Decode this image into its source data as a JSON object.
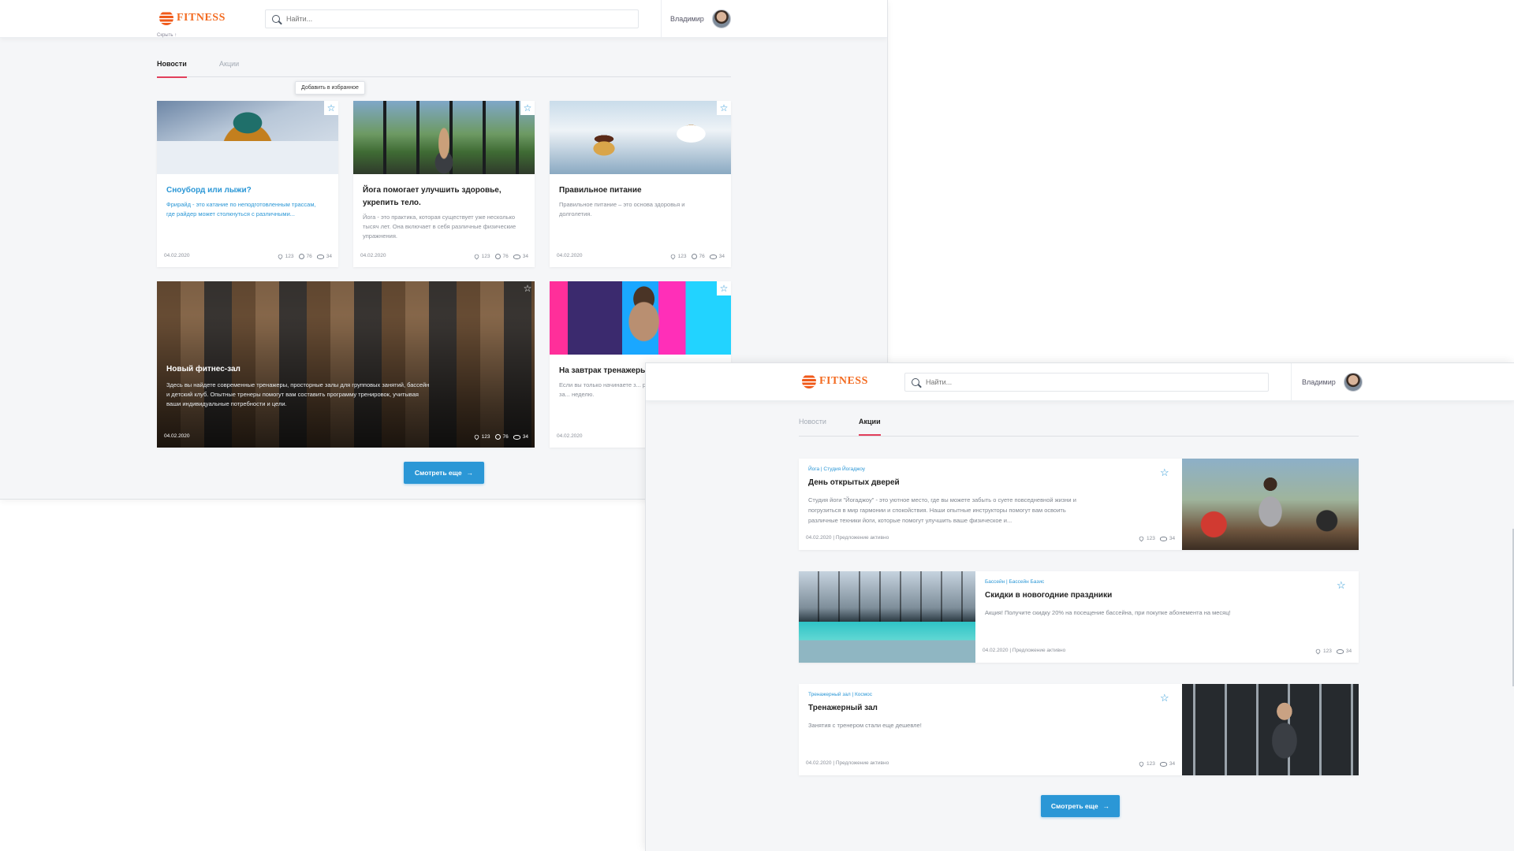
{
  "news_window": {
    "logo_text": "FITNESS",
    "search_placeholder": "Найти...",
    "user_name": "Владимир",
    "crumb": "Скрыть ↑",
    "tabs": [
      "Новости",
      "Акции"
    ],
    "tooltip": "Добавить в избранное",
    "cards": [
      {
        "title": "Сноуборд или лыжи?",
        "excerpt": "Фрирайд - это катание по неподготовленным трассам, где райдер может столкнуться с различными...",
        "date": "04.02.2020",
        "likes": "123",
        "comments": "76",
        "views": "34"
      },
      {
        "title": "Йога помогает улучшить здоровье, укрепить тело.",
        "excerpt": "Йога - это практика, которая существует уже несколько тысяч лет. Она включает в себя различные физические упражнения.",
        "date": "04.02.2020",
        "likes": "123",
        "comments": "76",
        "views": "34"
      },
      {
        "title": "Правильное питание",
        "excerpt": "Правильное питание – это основа здоровья и долголетия.",
        "date": "04.02.2020",
        "likes": "123",
        "comments": "76",
        "views": "34"
      },
      {
        "title": "Новый фитнес-зал",
        "excerpt": "Здесь вы найдете современные тренажеры, просторные залы для групповых занятий, бассейн и детский клуб. Опытные тренеры помогут вам составить программу тренировок, учитывая ваши индивидуальные потребности и цели.",
        "date": "04.02.2020",
        "likes": "123",
        "comments": "76",
        "views": "34"
      },
      {
        "title": "На завтрак тренажеры",
        "excerpt": "Если вы только начинаете з... рекомендуется посещать за... неделю.",
        "date": "04.02.2020"
      }
    ],
    "more_label": "Смотреть еще"
  },
  "promo_window": {
    "logo_text": "FITNESS",
    "search_placeholder": "Найти...",
    "user_name": "Владимир",
    "tabs": [
      "Новости",
      "Акции"
    ],
    "promos": [
      {
        "tags": "Йога | Студия Йогаджоу",
        "title": "День открытых дверей",
        "desc": "Студия йоги \"Йогаджоу\" - это уютное место, где вы можете забыть о суете повседневной жизни и погрузиться в мир гармонии и спокойствия. Наши опытные инструкторы помогут вам освоить различные техники йоги, которые помогут улучшить ваше физическое и...",
        "footer": "04.02.2020 | Предложение активно",
        "likes": "123",
        "views": "34"
      },
      {
        "tags": "Бассейн | Бассейн Базис",
        "title": "Скидки в новогодние праздники",
        "desc": "Акция! Получите скидку 20% на посещение бассейна, при покупке абонемента на месяц!",
        "footer": "04.02.2020 | Предложение активно",
        "likes": "123",
        "views": "34"
      },
      {
        "tags": "Тренажерный зал | Космос",
        "title": "Тренажерный зал",
        "desc": "Занятия с тренером стали еще дешевле!",
        "footer": "04.02.2020 | Предложение активно",
        "likes": "123",
        "views": "34"
      }
    ],
    "more_label": "Смотреть еще"
  },
  "icons": {
    "star": "star-icon",
    "heart": "heart-icon",
    "comment": "comment-icon",
    "eye": "eye-icon",
    "search": "search-icon",
    "arrow": "arrow-right-icon"
  },
  "colors": {
    "accent": "#2b97d6",
    "tab_active": "#e23f5b",
    "logo": "#f36b21"
  }
}
